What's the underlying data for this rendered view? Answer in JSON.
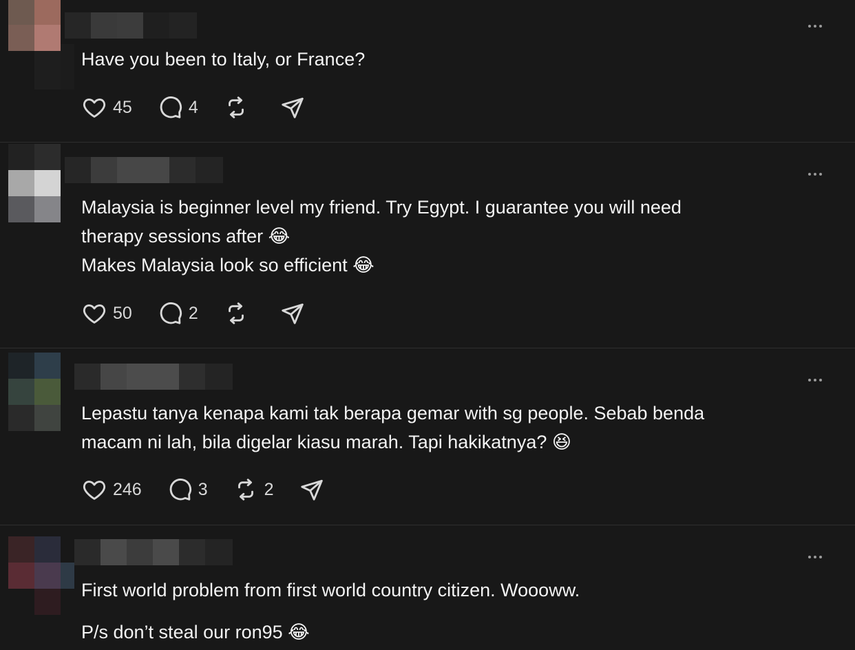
{
  "posts": [
    {
      "text_lines": [
        "Have you been to Italy, or France?"
      ],
      "likes": "45",
      "replies": "4",
      "reposts": ""
    },
    {
      "text_lines": [
        "Malaysia is beginner level my friend. Try Egypt. I guarantee you will need",
        "therapy sessions after 😂",
        "Makes Malaysia look so efficient 😂"
      ],
      "likes": "50",
      "replies": "2",
      "reposts": ""
    },
    {
      "text_lines": [
        "Lepastu tanya kenapa kami tak berapa gemar with sg people. Sebab benda",
        "macam ni lah, bila digelar kiasu marah. Tapi hakikatnya? 😆"
      ],
      "likes": "246",
      "replies": "3",
      "reposts": "2"
    },
    {
      "text_lines": [
        "First world problem from first world country citizen. Woooww.",
        "P/s don’t steal our ron95 😂"
      ],
      "likes": "",
      "replies": "",
      "reposts": ""
    }
  ],
  "icons": {
    "like": "heart-icon",
    "reply": "speech-bubble-icon",
    "repost": "repost-icon",
    "share": "paper-plane-icon",
    "more": "more-dots-icon"
  },
  "colors": {
    "background": "#181818",
    "text": "#f3f3f3",
    "icon": "#d8d8d8"
  }
}
